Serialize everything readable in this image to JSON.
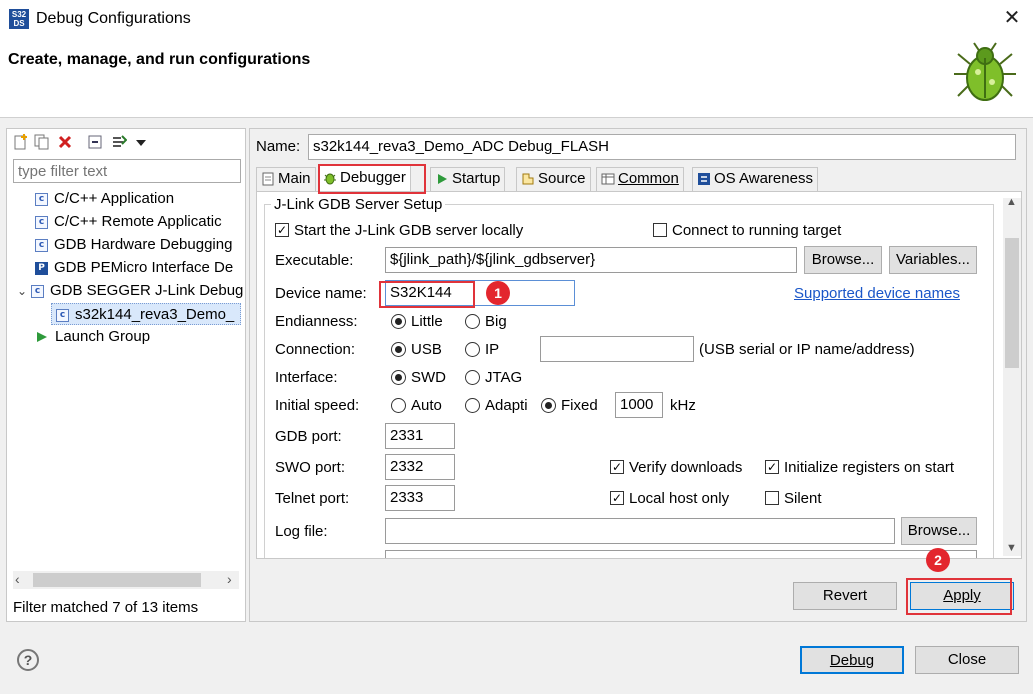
{
  "window": {
    "title": "Debug Configurations",
    "close_glyph": "✕",
    "icon_text": "S32 DS"
  },
  "banner": {
    "title": "Create, manage, and run configurations"
  },
  "left": {
    "filter_placeholder": "type filter text",
    "tree": [
      {
        "label": "C/C++ Application",
        "icon": "c-config-icon"
      },
      {
        "label": "C/C++ Remote Applicatic",
        "icon": "c-config-icon"
      },
      {
        "label": "GDB Hardware Debugging",
        "icon": "c-config-icon"
      },
      {
        "label": "GDB PEMicro Interface De",
        "icon": "pemicro-icon"
      },
      {
        "label": "GDB SEGGER J-Link Debug",
        "icon": "c-config-icon",
        "expanded": true
      },
      {
        "label": "s32k144_reva3_Demo_",
        "icon": "c-config-icon",
        "selected": true
      },
      {
        "label": "Launch Group",
        "icon": "launch-group-icon"
      }
    ],
    "status": "Filter matched 7 of 13 items"
  },
  "config": {
    "name_label": "Name:",
    "name_value": "s32k144_reva3_Demo_ADC Debug_FLASH",
    "tabs": [
      "Main",
      "Debugger",
      "Startup",
      "Source",
      "Common",
      "OS Awareness"
    ],
    "active_tab": "Debugger"
  },
  "jlink": {
    "group_title": "J-Link GDB Server Setup",
    "start_locally": "Start the J-Link GDB server locally",
    "connect_running": "Connect to running target",
    "executable_label": "Executable:",
    "executable_value": "${jlink_path}/${jlink_gdbserver}",
    "browse": "Browse...",
    "variables": "Variables...",
    "device_label": "Device name:",
    "device_value": "S32K144",
    "supported_link": "Supported device names",
    "endianness_label": "Endianness:",
    "endian_little": "Little",
    "endian_big": "Big",
    "connection_label": "Connection:",
    "conn_usb": "USB",
    "conn_ip": "IP",
    "conn_hint": "(USB serial or IP name/address)",
    "interface_label": "Interface:",
    "if_swd": "SWD",
    "if_jtag": "JTAG",
    "speed_label": "Initial speed:",
    "speed_auto": "Auto",
    "speed_adaptive": "Adapti",
    "speed_fixed": "Fixed",
    "speed_value": "1000",
    "speed_unit": "kHz",
    "gdb_port_label": "GDB port:",
    "gdb_port": "2331",
    "swo_port_label": "SWO port:",
    "swo_port": "2332",
    "telnet_port_label": "Telnet port:",
    "telnet_port": "2333",
    "verify_downloads": "Verify downloads",
    "init_registers": "Initialize registers on start",
    "local_host_only": "Local host only",
    "silent": "Silent",
    "log_file_label": "Log file:",
    "check_mark": "✓"
  },
  "buttons": {
    "revert": "Revert",
    "apply": "Apply",
    "debug": "Debug",
    "close": "Close",
    "help": "?"
  },
  "annotations": {
    "badge1": "1",
    "badge2": "2"
  },
  "colors": {
    "highlight": "#e0333a",
    "link": "#1a56c8",
    "selection": "#d9e8fb"
  }
}
